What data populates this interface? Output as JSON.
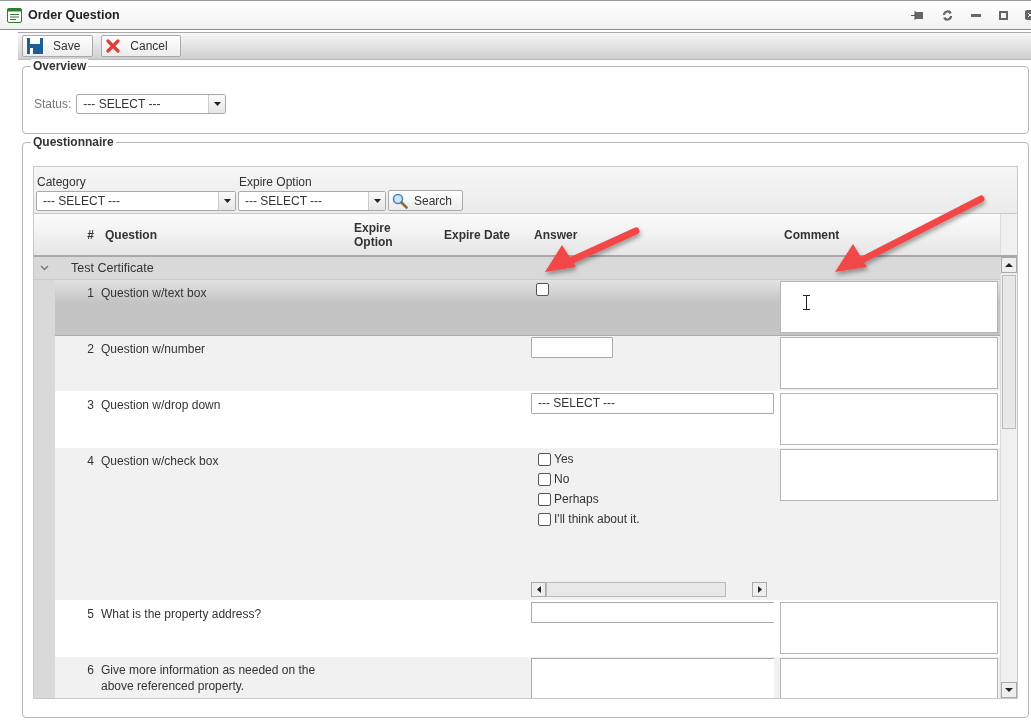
{
  "window": {
    "title": "Order Question"
  },
  "toolbar": {
    "buttons": [
      {
        "kind": "save",
        "label": "Save"
      },
      {
        "kind": "cancel",
        "label": "Cancel"
      }
    ]
  },
  "overview": {
    "legend": "Overview",
    "status": {
      "label": "Status:",
      "value": "--- SELECT ---"
    }
  },
  "questionnaire": {
    "legend": "Questionnaire",
    "filters": [
      {
        "label": "Category",
        "value": "--- SELECT ---"
      },
      {
        "label": "Expire Option",
        "value": "--- SELECT ---"
      }
    ],
    "search_button": "Search",
    "columns": [
      "#",
      "Question",
      "Expire Option",
      "Expire Date",
      "Answer",
      "Comment"
    ],
    "group": {
      "title": "Test Certificate",
      "expanded": true
    },
    "rows": [
      {
        "number": "1",
        "question": "Question w/text box",
        "selected": true,
        "answer": {
          "kind": "checkbox",
          "checked": false
        }
      },
      {
        "number": "2",
        "question": "Question w/number",
        "selected": false,
        "answer": {
          "kind": "number"
        }
      },
      {
        "number": "3",
        "question": "Question w/drop down",
        "selected": false,
        "answer": {
          "kind": "dropdown",
          "value": "--- SELECT ---"
        }
      },
      {
        "number": "4",
        "question": "Question w/check box",
        "selected": false,
        "answer": {
          "kind": "checklist",
          "options": [
            {
              "label": "Yes",
              "checked": false
            },
            {
              "label": "No",
              "checked": false
            },
            {
              "label": "Perhaps",
              "checked": false
            },
            {
              "label": "I'll think about it.",
              "checked": false
            }
          ]
        }
      },
      {
        "number": "5",
        "question": "What is the property address?",
        "selected": false,
        "answer": {
          "kind": "text"
        }
      },
      {
        "number": "6",
        "question": "Give more information as needed on the above referenced property.",
        "selected": false,
        "answer": {
          "kind": "textarea"
        }
      }
    ]
  }
}
